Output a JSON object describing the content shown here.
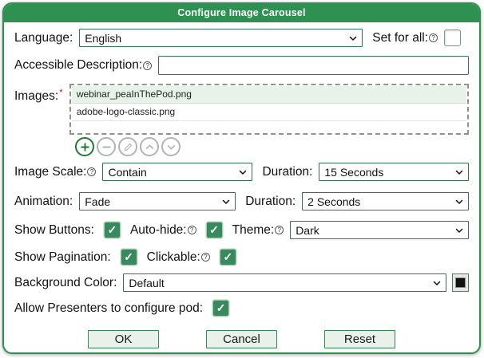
{
  "dialog": {
    "title": "Configure Image Carousel"
  },
  "icons": {
    "help": "?",
    "check": "✓",
    "required": "*"
  },
  "colors": {
    "accent_green": "#2e9152",
    "checkbox_green": "#388a5e",
    "swatch_color": "#111111"
  },
  "language": {
    "label": "Language:",
    "value": "English"
  },
  "set_for_all": {
    "label": "Set for all:",
    "state": "unchecked"
  },
  "accessible_description": {
    "label": "Accessible Description:",
    "value": ""
  },
  "images": {
    "label": "Images:",
    "items": [
      {
        "name": "webinar_peaInThePod.png",
        "selected": true
      },
      {
        "name": "adobe-logo-classic.png",
        "selected": false
      }
    ]
  },
  "image_scale": {
    "label": "Image Scale:",
    "value": "Contain"
  },
  "slide_duration": {
    "label": "Duration:",
    "value": "15 Seconds"
  },
  "animation": {
    "label": "Animation:",
    "value": "Fade"
  },
  "animation_duration": {
    "label": "Duration:",
    "value": "2 Seconds"
  },
  "show_buttons": {
    "label": "Show Buttons:",
    "state": "checked"
  },
  "auto_hide": {
    "label": "Auto-hide:",
    "state": "checked"
  },
  "theme": {
    "label": "Theme:",
    "value": "Dark"
  },
  "show_pagination": {
    "label": "Show Pagination:",
    "state": "checked"
  },
  "clickable": {
    "label": "Clickable:",
    "state": "checked"
  },
  "background_color": {
    "label": "Background Color:",
    "value": "Default"
  },
  "allow_presenters": {
    "label": "Allow Presenters to configure pod:",
    "state": "checked"
  },
  "footer": {
    "ok": "OK",
    "cancel": "Cancel",
    "reset": "Reset"
  }
}
